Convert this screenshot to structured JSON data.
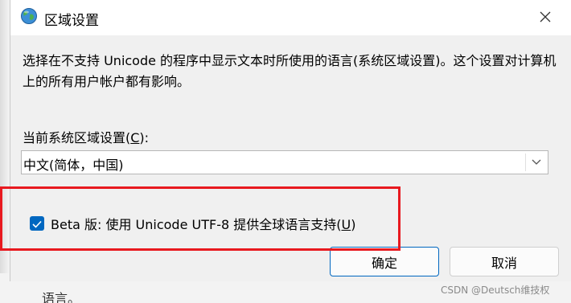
{
  "underlying_window": {
    "visible_text": "语言。"
  },
  "dialog": {
    "title": "区域设置",
    "title_icon": "globe-icon",
    "close_icon": "close-icon",
    "description": "选择在不支持 Unicode 的程序中显示文本时所使用的语言(系统区域设置)。这个设置对计算机上的所有用户帐户都有影响。",
    "locale_label": {
      "before": "当前系统区域设置(",
      "accelerator": "C",
      "after": "):"
    },
    "locale_select": {
      "value": "中文(简体，中国)",
      "arrow_icon": "chevron-down-icon"
    },
    "beta_checkbox": {
      "checked": true,
      "label_before": "Beta 版: 使用 Unicode UTF-8 提供全球语言支持(",
      "accelerator": "U",
      "label_after": ")"
    },
    "ok_button": "确定",
    "cancel_button": "取消"
  },
  "annotation": {
    "highlight_color": "#e8191f"
  },
  "watermark": "CSDN @Deutsch维技权",
  "colors": {
    "accent": "#0067c0",
    "dialog_bg": "#f0f0f0",
    "titlebar_bg": "#ffffff"
  }
}
